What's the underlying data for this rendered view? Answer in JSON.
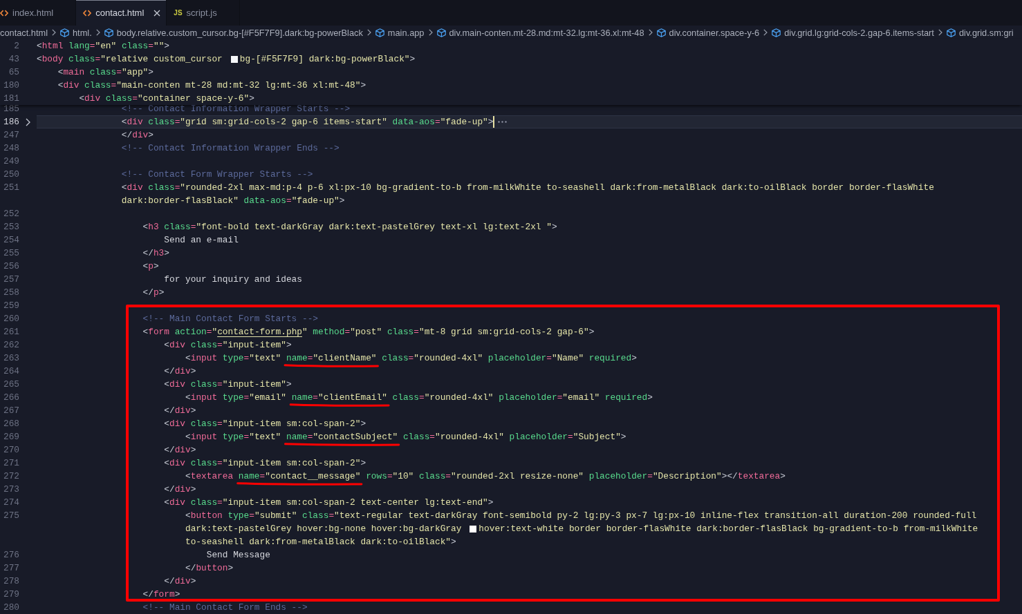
{
  "tabs": [
    {
      "kind": "html",
      "label": "index.html",
      "selected": false
    },
    {
      "kind": "html",
      "label": "contact.html",
      "selected": true
    },
    {
      "kind": "js",
      "icon_text": "JS",
      "label": "script.js",
      "selected": false
    }
  ],
  "breadcrumbs": [
    {
      "kind": "file",
      "label": "contact.html"
    },
    {
      "kind": "element",
      "label": "html."
    },
    {
      "kind": "element",
      "label": "body.relative.custom_cursor.bg-[#F5F7F9].dark:bg-powerBlack"
    },
    {
      "kind": "element",
      "label": "main.app"
    },
    {
      "kind": "element",
      "label": "div.main-conten.mt-28.md:mt-32.lg:mt-36.xl:mt-48"
    },
    {
      "kind": "element",
      "label": "div.container.space-y-6"
    },
    {
      "kind": "element",
      "label": "div.grid.lg:grid-cols-2.gap-6.items-start"
    },
    {
      "kind": "element",
      "label": "div.grid.sm:gri"
    }
  ],
  "editor": {
    "sticky_lines": [
      {
        "kind": "line",
        "number": "2",
        "tokens": [
          {
            "kind": "punct",
            "text": "<"
          },
          {
            "kind": "tag",
            "text": "html"
          },
          {
            "kind": "attr",
            "text": " lang"
          },
          {
            "kind": "op",
            "text": "="
          },
          {
            "kind": "string",
            "text": "\"en\""
          },
          {
            "kind": "attr",
            "text": " class"
          },
          {
            "kind": "op",
            "text": "="
          },
          {
            "kind": "string",
            "text": "\"\""
          },
          {
            "kind": "punct",
            "text": ">"
          }
        ]
      },
      {
        "kind": "line",
        "number": "43",
        "tokens": [
          {
            "kind": "punct",
            "text": "<"
          },
          {
            "kind": "tag",
            "text": "body"
          },
          {
            "kind": "attr",
            "text": " class"
          },
          {
            "kind": "op",
            "text": "="
          },
          {
            "kind": "string",
            "text": "\"relative custom_cursor"
          },
          {
            "kind": "swatch",
            "color": "#f5f7f9"
          },
          {
            "kind": "string",
            "text": "bg-[#F5F7F9] dark:bg-powerBlack\""
          },
          {
            "kind": "punct",
            "text": ">"
          }
        ],
        "children": [
          {
            "kind": "line",
            "number": "65",
            "tokens": [
              {
                "kind": "punct",
                "text": "<"
              },
              {
                "kind": "tag",
                "text": "main"
              },
              {
                "kind": "attr",
                "text": " class"
              },
              {
                "kind": "op",
                "text": "="
              },
              {
                "kind": "string",
                "text": "\"app\""
              },
              {
                "kind": "punct",
                "text": ">"
              }
            ]
          },
          {
            "kind": "line",
            "number": "180",
            "tokens": [
              {
                "kind": "punct",
                "text": "<"
              },
              {
                "kind": "tag",
                "text": "div"
              },
              {
                "kind": "attr",
                "text": " class"
              },
              {
                "kind": "op",
                "text": "="
              },
              {
                "kind": "string",
                "text": "\"main-conten mt-28 md:mt-32 lg:mt-36 xl:mt-48\""
              },
              {
                "kind": "punct",
                "text": ">"
              }
            ],
            "children": [
              {
                "kind": "line",
                "number": "181",
                "tokens": [
                  {
                    "kind": "punct",
                    "text": "<"
                  },
                  {
                    "kind": "tag",
                    "text": "div"
                  },
                  {
                    "kind": "attr",
                    "text": " class"
                  },
                  {
                    "kind": "op",
                    "text": "="
                  },
                  {
                    "kind": "string",
                    "text": "\"container space-y-6\""
                  },
                  {
                    "kind": "punct",
                    "text": ">"
                  }
                ]
              }
            ]
          }
        ]
      }
    ],
    "lines": [
      {
        "kind": "line",
        "number": "185",
        "current": false,
        "tokens": [
          {
            "kind": "comment",
            "text": "<!-- Contact Information Wrapper Starts -->"
          }
        ]
      },
      {
        "kind": "line",
        "number": "186",
        "folded": true,
        "current": true,
        "tokens": [
          {
            "kind": "punct",
            "text": "<"
          },
          {
            "kind": "tag",
            "text": "div"
          },
          {
            "kind": "attr",
            "text": " class"
          },
          {
            "kind": "op",
            "text": "="
          },
          {
            "kind": "string",
            "text": "\"grid sm:grid-cols-2 gap-6 items-start\""
          },
          {
            "kind": "attr",
            "text": " data-aos"
          },
          {
            "kind": "op",
            "text": "="
          },
          {
            "kind": "string",
            "text": "\"fade-up\""
          },
          {
            "kind": "punct",
            "text": ">"
          }
        ]
      },
      {
        "kind": "line",
        "number": "247",
        "current": false,
        "tokens": [
          {
            "kind": "punct",
            "text": "</"
          },
          {
            "kind": "tag",
            "text": "div"
          },
          {
            "kind": "punct",
            "text": ">"
          }
        ]
      },
      {
        "kind": "line",
        "number": "248",
        "current": false,
        "tokens": [
          {
            "kind": "comment",
            "text": "<!-- Contact Information Wrapper Ends -->"
          }
        ]
      },
      {
        "kind": "line",
        "number": "249",
        "current": false
      },
      {
        "kind": "line",
        "number": "250",
        "current": false,
        "tokens": [
          {
            "kind": "comment",
            "text": "<!-- Contact Form Wrapper Starts -->"
          }
        ]
      },
      {
        "kind": "line",
        "number": "251",
        "current": false,
        "wrapped_rows": [
          {
            "tokens": [
              {
                "kind": "punct",
                "text": "<"
              },
              {
                "kind": "tag",
                "text": "div"
              },
              {
                "kind": "attr",
                "text": " class"
              },
              {
                "kind": "op",
                "text": "="
              },
              {
                "kind": "string",
                "text": "\"rounded-2xl max-md:p-4 p-6 xl:px-10 bg-gradient-to-b from-milkWhite to-seashell dark:from-metalBlack dark:to-oilBlack border border-flasWhite"
              }
            ]
          },
          {
            "tokens": [
              {
                "kind": "string",
                "text": "dark:border-flasBlack\""
              },
              {
                "kind": "attr",
                "text": " data-aos"
              },
              {
                "kind": "op",
                "text": "="
              },
              {
                "kind": "string",
                "text": "\"fade-up\""
              },
              {
                "kind": "punct",
                "text": ">"
              }
            ]
          }
        ],
        "children": [
          {
            "kind": "line",
            "number": "252",
            "current": false
          },
          {
            "kind": "line",
            "number": "253",
            "current": false,
            "tokens": [
              {
                "kind": "punct",
                "text": "<"
              },
              {
                "kind": "tag",
                "text": "h3"
              },
              {
                "kind": "attr",
                "text": " class"
              },
              {
                "kind": "op",
                "text": "="
              },
              {
                "kind": "string",
                "text": "\"font-bold text-darkGray dark:text-pastelGrey text-xl lg:text-2xl \""
              },
              {
                "kind": "punct",
                "text": ">"
              }
            ],
            "children": [
              {
                "kind": "line",
                "number": "254",
                "current": false,
                "tokens": [
                  {
                    "kind": "text",
                    "text": "Send an e-mail"
                  }
                ]
              }
            ]
          },
          {
            "kind": "line",
            "number": "255",
            "current": false,
            "tokens": [
              {
                "kind": "punct",
                "text": "</"
              },
              {
                "kind": "tag",
                "text": "h3"
              },
              {
                "kind": "punct",
                "text": ">"
              }
            ]
          },
          {
            "kind": "line",
            "number": "256",
            "current": false,
            "tokens": [
              {
                "kind": "punct",
                "text": "<"
              },
              {
                "kind": "tag",
                "text": "p"
              },
              {
                "kind": "punct",
                "text": ">"
              }
            ],
            "children": [
              {
                "kind": "line",
                "number": "257",
                "current": false,
                "tokens": [
                  {
                    "kind": "text",
                    "text": "for your inquiry and ideas"
                  }
                ]
              }
            ]
          },
          {
            "kind": "line",
            "number": "258",
            "current": false,
            "tokens": [
              {
                "kind": "punct",
                "text": "</"
              },
              {
                "kind": "tag",
                "text": "p"
              },
              {
                "kind": "punct",
                "text": ">"
              }
            ]
          },
          {
            "kind": "line",
            "number": "259",
            "current": false
          },
          {
            "kind": "annotation_box",
            "lines": [
              {
                "kind": "line",
                "number": "260",
                "current": false,
                "tokens": [
                  {
                    "kind": "comment",
                    "text": "<!-- Main Contact Form Starts -->"
                  }
                ]
              },
              {
                "kind": "line",
                "number": "261",
                "current": false,
                "tokens": [
                  {
                    "kind": "punct",
                    "text": "<"
                  },
                  {
                    "kind": "tag",
                    "text": "form"
                  },
                  {
                    "kind": "attr",
                    "text": " action"
                  },
                  {
                    "kind": "op",
                    "text": "="
                  },
                  {
                    "kind": "string",
                    "text": "\""
                  },
                  {
                    "kind": "link",
                    "text": "contact-form.php"
                  },
                  {
                    "kind": "string",
                    "text": "\""
                  },
                  {
                    "kind": "attr",
                    "text": " method"
                  },
                  {
                    "kind": "op",
                    "text": "="
                  },
                  {
                    "kind": "string",
                    "text": "\"post\""
                  },
                  {
                    "kind": "attr",
                    "text": " class"
                  },
                  {
                    "kind": "op",
                    "text": "="
                  },
                  {
                    "kind": "string",
                    "text": "\"mt-8 grid sm:grid-cols-2 gap-6\""
                  },
                  {
                    "kind": "punct",
                    "text": ">"
                  }
                ],
                "children": [
                  {
                    "kind": "line",
                    "number": "262",
                    "current": false,
                    "tokens": [
                      {
                        "kind": "punct",
                        "text": "<"
                      },
                      {
                        "kind": "tag",
                        "text": "div"
                      },
                      {
                        "kind": "attr",
                        "text": " class"
                      },
                      {
                        "kind": "op",
                        "text": "="
                      },
                      {
                        "kind": "string",
                        "text": "\"input-item\""
                      },
                      {
                        "kind": "punct",
                        "text": ">"
                      }
                    ],
                    "children": [
                      {
                        "kind": "line",
                        "number": "263",
                        "current": false,
                        "tokens": [
                          {
                            "kind": "punct",
                            "text": "<"
                          },
                          {
                            "kind": "tag",
                            "text": "input"
                          },
                          {
                            "kind": "attr",
                            "text": " type"
                          },
                          {
                            "kind": "op",
                            "text": "="
                          },
                          {
                            "kind": "string",
                            "text": "\"text\" "
                          },
                          {
                            "kind": "underlined",
                            "tokens": [
                              {
                                "kind": "attr",
                                "text": "name"
                              },
                              {
                                "kind": "op",
                                "text": "="
                              },
                              {
                                "kind": "string",
                                "text": "\"clientName\""
                              }
                            ]
                          },
                          {
                            "kind": "attr",
                            "text": " class"
                          },
                          {
                            "kind": "op",
                            "text": "="
                          },
                          {
                            "kind": "string",
                            "text": "\"rounded-4xl\""
                          },
                          {
                            "kind": "attr",
                            "text": " placeholder"
                          },
                          {
                            "kind": "op",
                            "text": "="
                          },
                          {
                            "kind": "string",
                            "text": "\"Name\""
                          },
                          {
                            "kind": "attr",
                            "text": " required"
                          },
                          {
                            "kind": "punct",
                            "text": ">"
                          }
                        ]
                      }
                    ]
                  },
                  {
                    "kind": "line",
                    "number": "264",
                    "current": false,
                    "tokens": [
                      {
                        "kind": "punct",
                        "text": "</"
                      },
                      {
                        "kind": "tag",
                        "text": "div"
                      },
                      {
                        "kind": "punct",
                        "text": ">"
                      }
                    ]
                  },
                  {
                    "kind": "line",
                    "number": "265",
                    "current": false,
                    "tokens": [
                      {
                        "kind": "punct",
                        "text": "<"
                      },
                      {
                        "kind": "tag",
                        "text": "div"
                      },
                      {
                        "kind": "attr",
                        "text": " class"
                      },
                      {
                        "kind": "op",
                        "text": "="
                      },
                      {
                        "kind": "string",
                        "text": "\"input-item\""
                      },
                      {
                        "kind": "punct",
                        "text": ">"
                      }
                    ],
                    "children": [
                      {
                        "kind": "line",
                        "number": "266",
                        "current": false,
                        "tokens": [
                          {
                            "kind": "punct",
                            "text": "<"
                          },
                          {
                            "kind": "tag",
                            "text": "input"
                          },
                          {
                            "kind": "attr",
                            "text": " type"
                          },
                          {
                            "kind": "op",
                            "text": "="
                          },
                          {
                            "kind": "string",
                            "text": "\"email\" "
                          },
                          {
                            "kind": "underlined",
                            "tokens": [
                              {
                                "kind": "attr",
                                "text": "name"
                              },
                              {
                                "kind": "op",
                                "text": "="
                              },
                              {
                                "kind": "string",
                                "text": "\"clientEmail\""
                              }
                            ]
                          },
                          {
                            "kind": "attr",
                            "text": " class"
                          },
                          {
                            "kind": "op",
                            "text": "="
                          },
                          {
                            "kind": "string",
                            "text": "\"rounded-4xl\""
                          },
                          {
                            "kind": "attr",
                            "text": " placeholder"
                          },
                          {
                            "kind": "op",
                            "text": "="
                          },
                          {
                            "kind": "string",
                            "text": "\"email\""
                          },
                          {
                            "kind": "attr",
                            "text": " required"
                          },
                          {
                            "kind": "punct",
                            "text": ">"
                          }
                        ]
                      }
                    ]
                  },
                  {
                    "kind": "line",
                    "number": "267",
                    "current": false,
                    "tokens": [
                      {
                        "kind": "punct",
                        "text": "</"
                      },
                      {
                        "kind": "tag",
                        "text": "div"
                      },
                      {
                        "kind": "punct",
                        "text": ">"
                      }
                    ]
                  },
                  {
                    "kind": "line",
                    "number": "268",
                    "current": false,
                    "tokens": [
                      {
                        "kind": "punct",
                        "text": "<"
                      },
                      {
                        "kind": "tag",
                        "text": "div"
                      },
                      {
                        "kind": "attr",
                        "text": " class"
                      },
                      {
                        "kind": "op",
                        "text": "="
                      },
                      {
                        "kind": "string",
                        "text": "\"input-item sm:col-span-2\""
                      },
                      {
                        "kind": "punct",
                        "text": ">"
                      }
                    ],
                    "children": [
                      {
                        "kind": "line",
                        "number": "269",
                        "current": false,
                        "tokens": [
                          {
                            "kind": "punct",
                            "text": "<"
                          },
                          {
                            "kind": "tag",
                            "text": "input"
                          },
                          {
                            "kind": "attr",
                            "text": " type"
                          },
                          {
                            "kind": "op",
                            "text": "="
                          },
                          {
                            "kind": "string",
                            "text": "\"text\" "
                          },
                          {
                            "kind": "underlined",
                            "tokens": [
                              {
                                "kind": "attr",
                                "text": "name"
                              },
                              {
                                "kind": "op",
                                "text": "="
                              },
                              {
                                "kind": "string",
                                "text": "\"contactSubject\""
                              }
                            ]
                          },
                          {
                            "kind": "attr",
                            "text": " class"
                          },
                          {
                            "kind": "op",
                            "text": "="
                          },
                          {
                            "kind": "string",
                            "text": "\"rounded-4xl\""
                          },
                          {
                            "kind": "attr",
                            "text": " placeholder"
                          },
                          {
                            "kind": "op",
                            "text": "="
                          },
                          {
                            "kind": "string",
                            "text": "\"Subject\""
                          },
                          {
                            "kind": "punct",
                            "text": ">"
                          }
                        ]
                      }
                    ]
                  },
                  {
                    "kind": "line",
                    "number": "270",
                    "current": false,
                    "tokens": [
                      {
                        "kind": "punct",
                        "text": "</"
                      },
                      {
                        "kind": "tag",
                        "text": "div"
                      },
                      {
                        "kind": "punct",
                        "text": ">"
                      }
                    ]
                  },
                  {
                    "kind": "line",
                    "number": "271",
                    "current": false,
                    "tokens": [
                      {
                        "kind": "punct",
                        "text": "<"
                      },
                      {
                        "kind": "tag",
                        "text": "div"
                      },
                      {
                        "kind": "attr",
                        "text": " class"
                      },
                      {
                        "kind": "op",
                        "text": "="
                      },
                      {
                        "kind": "string",
                        "text": "\"input-item sm:col-span-2\""
                      },
                      {
                        "kind": "punct",
                        "text": ">"
                      }
                    ],
                    "children": [
                      {
                        "kind": "line",
                        "number": "272",
                        "current": false,
                        "tokens": [
                          {
                            "kind": "punct",
                            "text": "<"
                          },
                          {
                            "kind": "tag",
                            "text": "textarea "
                          },
                          {
                            "kind": "underlined",
                            "tokens": [
                              {
                                "kind": "attr",
                                "text": "name"
                              },
                              {
                                "kind": "op",
                                "text": "="
                              },
                              {
                                "kind": "string",
                                "text": "\"contact__message\""
                              }
                            ]
                          },
                          {
                            "kind": "attr",
                            "text": " rows"
                          },
                          {
                            "kind": "op",
                            "text": "="
                          },
                          {
                            "kind": "string",
                            "text": "\"10\""
                          },
                          {
                            "kind": "attr",
                            "text": " class"
                          },
                          {
                            "kind": "op",
                            "text": "="
                          },
                          {
                            "kind": "string",
                            "text": "\"rounded-2xl resize-none\""
                          },
                          {
                            "kind": "attr",
                            "text": " placeholder"
                          },
                          {
                            "kind": "op",
                            "text": "="
                          },
                          {
                            "kind": "string",
                            "text": "\"Description\""
                          },
                          {
                            "kind": "punct",
                            "text": "></"
                          },
                          {
                            "kind": "tag",
                            "text": "textarea"
                          },
                          {
                            "kind": "punct",
                            "text": ">"
                          }
                        ]
                      }
                    ]
                  },
                  {
                    "kind": "line",
                    "number": "273",
                    "current": false,
                    "tokens": [
                      {
                        "kind": "punct",
                        "text": "</"
                      },
                      {
                        "kind": "tag",
                        "text": "div"
                      },
                      {
                        "kind": "punct",
                        "text": ">"
                      }
                    ]
                  },
                  {
                    "kind": "line",
                    "number": "274",
                    "current": false,
                    "tokens": [
                      {
                        "kind": "punct",
                        "text": "<"
                      },
                      {
                        "kind": "tag",
                        "text": "div"
                      },
                      {
                        "kind": "attr",
                        "text": " class"
                      },
                      {
                        "kind": "op",
                        "text": "="
                      },
                      {
                        "kind": "string",
                        "text": "\"input-item sm:col-span-2 text-center lg:text-end\""
                      },
                      {
                        "kind": "punct",
                        "text": ">"
                      }
                    ],
                    "children": [
                      {
                        "kind": "line",
                        "number": "275",
                        "current": false,
                        "wrapped_rows": [
                          {
                            "tokens": [
                              {
                                "kind": "punct",
                                "text": "<"
                              },
                              {
                                "kind": "tag",
                                "text": "button"
                              },
                              {
                                "kind": "attr",
                                "text": " type"
                              },
                              {
                                "kind": "op",
                                "text": "="
                              },
                              {
                                "kind": "string",
                                "text": "\"submit\""
                              },
                              {
                                "kind": "attr",
                                "text": " class"
                              },
                              {
                                "kind": "op",
                                "text": "="
                              },
                              {
                                "kind": "string",
                                "text": "\"text-regular text-darkGray font-semibold py-2 lg:py-3 px-7 lg:px-10 inline-flex transition-all duration-200 rounded-full"
                              }
                            ]
                          },
                          {
                            "tokens": [
                              {
                                "kind": "string",
                                "text": "dark:text-pastelGrey hover:bg-none hover:bg-darkGray"
                              },
                              {
                                "kind": "swatch",
                                "color": "#ffffff"
                              },
                              {
                                "kind": "string",
                                "text": "hover:text-white border border-flasWhite dark:border-flasBlack bg-gradient-to-b from-milkWhite"
                              }
                            ]
                          },
                          {
                            "tokens": [
                              {
                                "kind": "string",
                                "text": "to-seashell dark:from-metalBlack dark:to-oilBlack\""
                              },
                              {
                                "kind": "punct",
                                "text": ">"
                              }
                            ]
                          }
                        ],
                        "children": [
                          {
                            "kind": "line",
                            "number": "276",
                            "current": false,
                            "tokens": [
                              {
                                "kind": "text",
                                "text": "Send Message"
                              }
                            ]
                          }
                        ]
                      },
                      {
                        "kind": "line",
                        "number": "277",
                        "current": false,
                        "tokens": [
                          {
                            "kind": "punct",
                            "text": "</"
                          },
                          {
                            "kind": "tag",
                            "text": "button"
                          },
                          {
                            "kind": "punct",
                            "text": ">"
                          }
                        ]
                      }
                    ]
                  },
                  {
                    "kind": "line",
                    "number": "278",
                    "current": false,
                    "tokens": [
                      {
                        "kind": "punct",
                        "text": "</"
                      },
                      {
                        "kind": "tag",
                        "text": "div"
                      },
                      {
                        "kind": "punct",
                        "text": ">"
                      }
                    ]
                  }
                ]
              },
              {
                "kind": "line",
                "number": "279",
                "current": false,
                "tokens": [
                  {
                    "kind": "punct",
                    "text": "</"
                  },
                  {
                    "kind": "tag",
                    "text": "form"
                  },
                  {
                    "kind": "punct",
                    "text": ">"
                  }
                ]
              }
            ]
          },
          {
            "kind": "line",
            "number": "280",
            "current": false,
            "tokens": [
              {
                "kind": "comment",
                "text": "<!-- Main Contact Form Ends -->"
              }
            ]
          }
        ]
      }
    ]
  }
}
